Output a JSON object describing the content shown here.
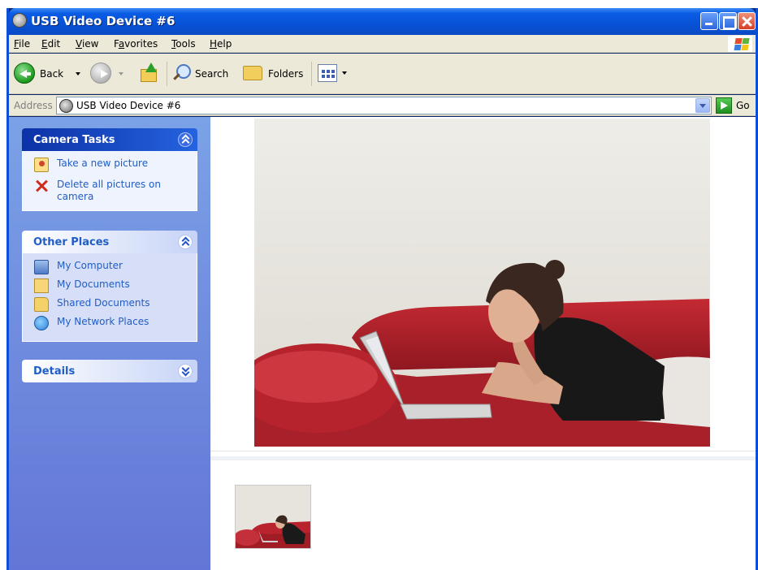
{
  "window": {
    "title": "USB Video Device #6"
  },
  "menubar": {
    "items": [
      {
        "pre": "",
        "u": "F",
        "post": "ile"
      },
      {
        "pre": "",
        "u": "E",
        "post": "dit"
      },
      {
        "pre": "",
        "u": "V",
        "post": "iew"
      },
      {
        "pre": "F",
        "u": "a",
        "post": "vorites"
      },
      {
        "pre": "",
        "u": "T",
        "post": "ools"
      },
      {
        "pre": "",
        "u": "H",
        "post": "elp"
      }
    ]
  },
  "toolbar": {
    "back_label": "Back",
    "search_label": "Search",
    "folders_label": "Folders"
  },
  "address": {
    "label": "Address",
    "value": "USB Video Device #6",
    "go_label": "Go"
  },
  "taskpane": {
    "camera_tasks": {
      "title": "Camera Tasks",
      "items": [
        {
          "label": "Take a new picture",
          "icon": "camera-icon"
        },
        {
          "label": "Delete all pictures on camera",
          "icon": "delete-icon"
        }
      ]
    },
    "other_places": {
      "title": "Other Places",
      "items": [
        {
          "label": "My Computer",
          "icon": "computer-icon"
        },
        {
          "label": "My Documents",
          "icon": "documents-icon"
        },
        {
          "label": "Shared Documents",
          "icon": "folder-icon"
        },
        {
          "label": "My Network Places",
          "icon": "network-icon"
        }
      ]
    },
    "details": {
      "title": "Details"
    }
  },
  "colors": {
    "title_bar": "#0752d6",
    "task_link": "#215dc6",
    "taskpane_top": "#7ba2e7",
    "taskpane_bottom": "#6375d6",
    "sofa_red": "#b5202c"
  }
}
